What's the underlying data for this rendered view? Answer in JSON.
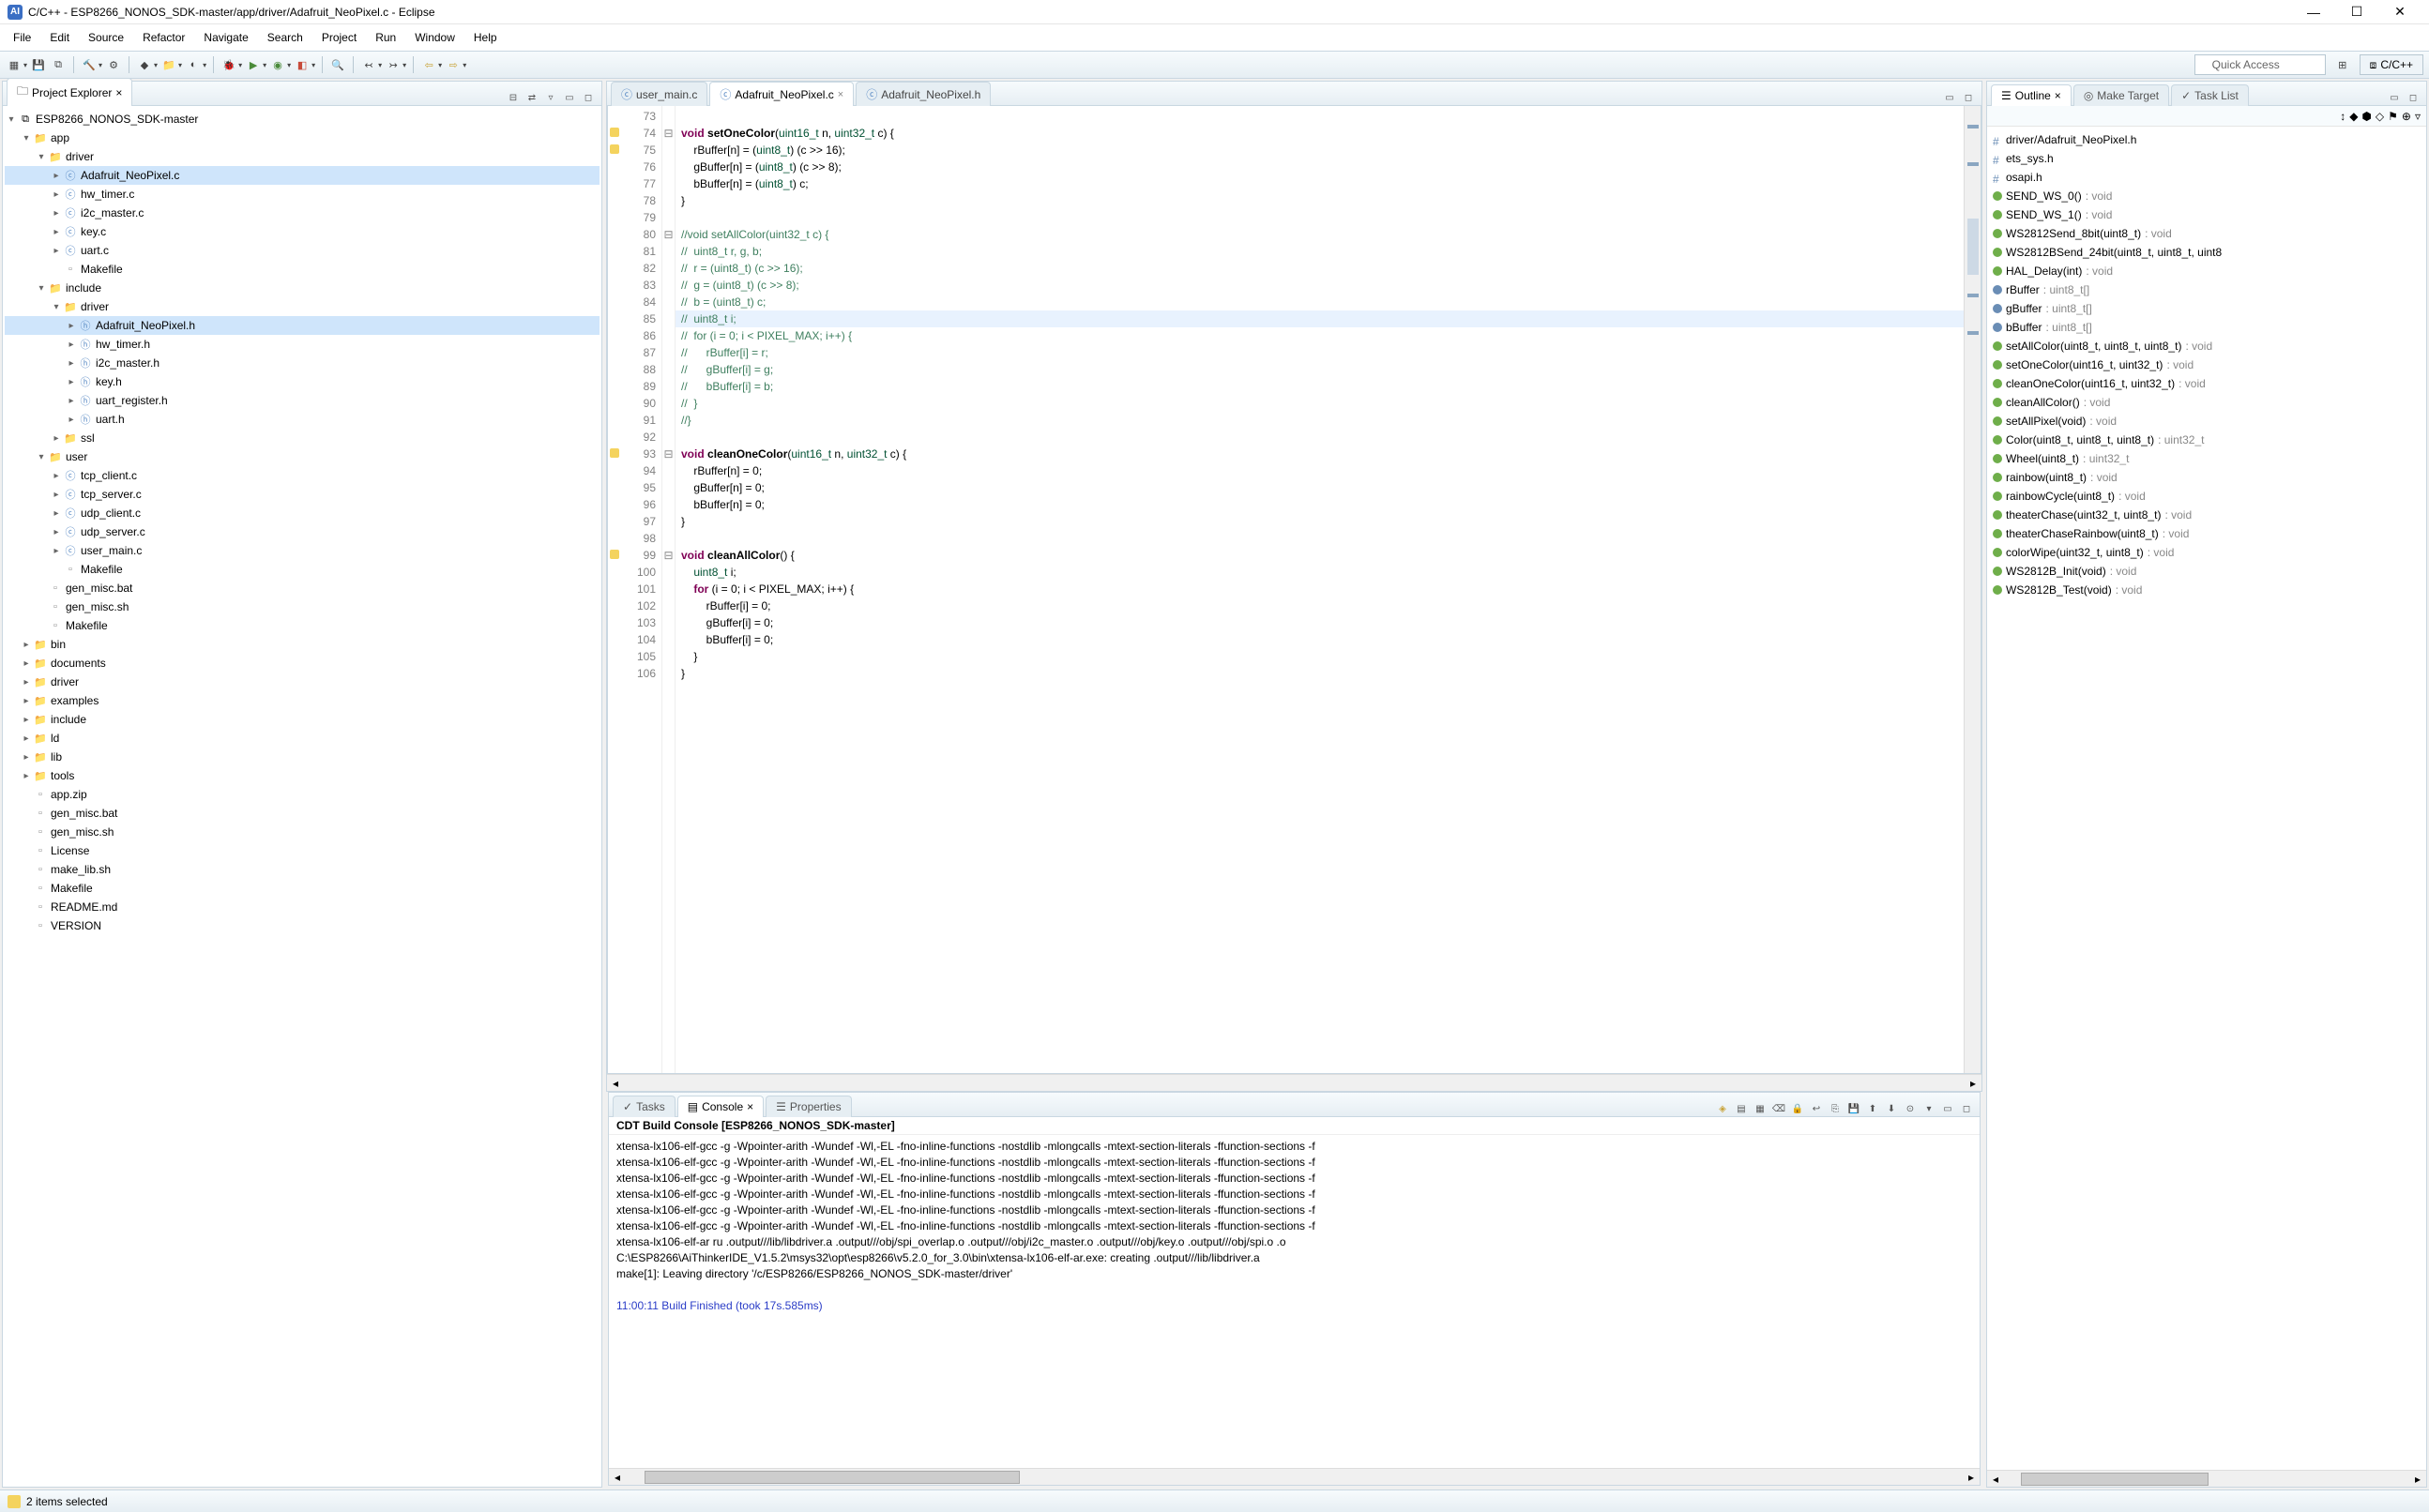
{
  "window": {
    "title": "C/C++ - ESP8266_NONOS_SDK-master/app/driver/Adafruit_NeoPixel.c - Eclipse",
    "app_icon_letter": "AI"
  },
  "menu": [
    "File",
    "Edit",
    "Source",
    "Refactor",
    "Navigate",
    "Search",
    "Project",
    "Run",
    "Window",
    "Help"
  ],
  "toolbar": {
    "quick_access": "Quick Access",
    "perspective": "C/C++"
  },
  "project_explorer": {
    "tab": "Project Explorer",
    "tree": [
      {
        "d": 0,
        "t": "v",
        "i": "proj",
        "l": "ESP8266_NONOS_SDK-master"
      },
      {
        "d": 1,
        "t": "v",
        "i": "folder",
        "l": "app"
      },
      {
        "d": 2,
        "t": "v",
        "i": "folder",
        "l": "driver"
      },
      {
        "d": 3,
        "t": ">",
        "i": "cfile",
        "l": "Adafruit_NeoPixel.c",
        "sel": true
      },
      {
        "d": 3,
        "t": ">",
        "i": "cfile",
        "l": "hw_timer.c"
      },
      {
        "d": 3,
        "t": ">",
        "i": "cfile",
        "l": "i2c_master.c"
      },
      {
        "d": 3,
        "t": ">",
        "i": "cfile",
        "l": "key.c"
      },
      {
        "d": 3,
        "t": ">",
        "i": "cfile",
        "l": "uart.c"
      },
      {
        "d": 3,
        "t": "",
        "i": "file",
        "l": "Makefile"
      },
      {
        "d": 2,
        "t": "v",
        "i": "folder",
        "l": "include"
      },
      {
        "d": 3,
        "t": "v",
        "i": "folder",
        "l": "driver"
      },
      {
        "d": 4,
        "t": ">",
        "i": "hfile",
        "l": "Adafruit_NeoPixel.h",
        "sel": true
      },
      {
        "d": 4,
        "t": ">",
        "i": "hfile",
        "l": "hw_timer.h"
      },
      {
        "d": 4,
        "t": ">",
        "i": "hfile",
        "l": "i2c_master.h"
      },
      {
        "d": 4,
        "t": ">",
        "i": "hfile",
        "l": "key.h"
      },
      {
        "d": 4,
        "t": ">",
        "i": "hfile",
        "l": "uart_register.h"
      },
      {
        "d": 4,
        "t": ">",
        "i": "hfile",
        "l": "uart.h"
      },
      {
        "d": 3,
        "t": ">",
        "i": "folder",
        "l": "ssl"
      },
      {
        "d": 2,
        "t": "v",
        "i": "folder",
        "l": "user"
      },
      {
        "d": 3,
        "t": ">",
        "i": "cfile",
        "l": "tcp_client.c"
      },
      {
        "d": 3,
        "t": ">",
        "i": "cfile",
        "l": "tcp_server.c"
      },
      {
        "d": 3,
        "t": ">",
        "i": "cfile",
        "l": "udp_client.c"
      },
      {
        "d": 3,
        "t": ">",
        "i": "cfile",
        "l": "udp_server.c"
      },
      {
        "d": 3,
        "t": ">",
        "i": "cfile",
        "l": "user_main.c"
      },
      {
        "d": 3,
        "t": "",
        "i": "file",
        "l": "Makefile"
      },
      {
        "d": 2,
        "t": "",
        "i": "file",
        "l": "gen_misc.bat"
      },
      {
        "d": 2,
        "t": "",
        "i": "file",
        "l": "gen_misc.sh"
      },
      {
        "d": 2,
        "t": "",
        "i": "file",
        "l": "Makefile"
      },
      {
        "d": 1,
        "t": ">",
        "i": "folder",
        "l": "bin"
      },
      {
        "d": 1,
        "t": ">",
        "i": "folder",
        "l": "documents"
      },
      {
        "d": 1,
        "t": ">",
        "i": "folder",
        "l": "driver"
      },
      {
        "d": 1,
        "t": ">",
        "i": "folder",
        "l": "examples"
      },
      {
        "d": 1,
        "t": ">",
        "i": "folder",
        "l": "include"
      },
      {
        "d": 1,
        "t": ">",
        "i": "folder",
        "l": "ld"
      },
      {
        "d": 1,
        "t": ">",
        "i": "folder",
        "l": "lib"
      },
      {
        "d": 1,
        "t": ">",
        "i": "folder",
        "l": "tools"
      },
      {
        "d": 1,
        "t": "",
        "i": "file",
        "l": "app.zip"
      },
      {
        "d": 1,
        "t": "",
        "i": "file",
        "l": "gen_misc.bat"
      },
      {
        "d": 1,
        "t": "",
        "i": "file",
        "l": "gen_misc.sh"
      },
      {
        "d": 1,
        "t": "",
        "i": "file",
        "l": "License"
      },
      {
        "d": 1,
        "t": "",
        "i": "file",
        "l": "make_lib.sh"
      },
      {
        "d": 1,
        "t": "",
        "i": "file",
        "l": "Makefile"
      },
      {
        "d": 1,
        "t": "",
        "i": "file",
        "l": "README.md"
      },
      {
        "d": 1,
        "t": "",
        "i": "file",
        "l": "VERSION"
      }
    ]
  },
  "editor": {
    "tabs": [
      {
        "label": "user_main.c",
        "active": false
      },
      {
        "label": "Adafruit_NeoPixel.c",
        "active": true
      },
      {
        "label": "Adafruit_NeoPixel.h",
        "active": false
      }
    ],
    "first_line": 73,
    "highlight_line": 85,
    "lines": [
      {
        "n": 73,
        "html": ""
      },
      {
        "n": 74,
        "mark": "warn",
        "fold": "⊟",
        "html": "<span class='kw'>void</span> <span class='fn'>setOneColor</span>(<span class='type'>uint16_t</span> n, <span class='type'>uint32_t</span> c) {"
      },
      {
        "n": 75,
        "mark": "warn",
        "html": "    rBuffer[n] = (<span class='type'>uint8_t</span>) (c &gt;&gt; 16);"
      },
      {
        "n": 76,
        "html": "    gBuffer[n] = (<span class='type'>uint8_t</span>) (c &gt;&gt; 8);"
      },
      {
        "n": 77,
        "html": "    bBuffer[n] = (<span class='type'>uint8_t</span>) c;"
      },
      {
        "n": 78,
        "html": "}"
      },
      {
        "n": 79,
        "html": ""
      },
      {
        "n": 80,
        "fold": "⊟",
        "html": "<span class='cmt'>//void setAllColor(uint32_t c) {</span>"
      },
      {
        "n": 81,
        "html": "<span class='cmt'>//  uint8_t r, g, b;</span>"
      },
      {
        "n": 82,
        "html": "<span class='cmt'>//  r = (uint8_t) (c &gt;&gt; 16);</span>"
      },
      {
        "n": 83,
        "html": "<span class='cmt'>//  g = (uint8_t) (c &gt;&gt; 8);</span>"
      },
      {
        "n": 84,
        "html": "<span class='cmt'>//  b = (uint8_t) c;</span>"
      },
      {
        "n": 85,
        "html": "<span class='cmt'>//  uint8_t i;</span>"
      },
      {
        "n": 86,
        "html": "<span class='cmt'>//  for (i = 0; i &lt; PIXEL_MAX; i++) {</span>"
      },
      {
        "n": 87,
        "html": "<span class='cmt'>//      rBuffer[i] = r;</span>"
      },
      {
        "n": 88,
        "html": "<span class='cmt'>//      gBuffer[i] = g;</span>"
      },
      {
        "n": 89,
        "html": "<span class='cmt'>//      bBuffer[i] = b;</span>"
      },
      {
        "n": 90,
        "html": "<span class='cmt'>//  }</span>"
      },
      {
        "n": 91,
        "html": "<span class='cmt'>//}</span>"
      },
      {
        "n": 92,
        "html": ""
      },
      {
        "n": 93,
        "mark": "warn",
        "fold": "⊟",
        "html": "<span class='kw'>void</span> <span class='fn'>cleanOneColor</span>(<span class='type'>uint16_t</span> n, <span class='type'>uint32_t</span> c) {"
      },
      {
        "n": 94,
        "html": "    rBuffer[n] = 0;"
      },
      {
        "n": 95,
        "html": "    gBuffer[n] = 0;"
      },
      {
        "n": 96,
        "html": "    bBuffer[n] = 0;"
      },
      {
        "n": 97,
        "html": "}"
      },
      {
        "n": 98,
        "html": ""
      },
      {
        "n": 99,
        "mark": "warn",
        "fold": "⊟",
        "html": "<span class='kw'>void</span> <span class='fn'>cleanAllColor</span>() {"
      },
      {
        "n": 100,
        "html": "    <span class='type'>uint8_t</span> i;"
      },
      {
        "n": 101,
        "html": "    <span class='kw'>for</span> (i = 0; i &lt; PIXEL_MAX; i++) {"
      },
      {
        "n": 102,
        "html": "        rBuffer[i] = 0;"
      },
      {
        "n": 103,
        "html": "        gBuffer[i] = 0;"
      },
      {
        "n": 104,
        "html": "        bBuffer[i] = 0;"
      },
      {
        "n": 105,
        "html": "    }"
      },
      {
        "n": 106,
        "html": "}"
      }
    ]
  },
  "outline": {
    "tabs": [
      "Outline",
      "Make Target",
      "Task List"
    ],
    "items": [
      {
        "k": "inc",
        "nm": "driver/Adafruit_NeoPixel.h"
      },
      {
        "k": "inc",
        "nm": "ets_sys.h"
      },
      {
        "k": "inc",
        "nm": "osapi.h"
      },
      {
        "k": "fn",
        "nm": "SEND_WS_0()",
        "ret": " : void"
      },
      {
        "k": "fn",
        "nm": "SEND_WS_1()",
        "ret": " : void"
      },
      {
        "k": "fn",
        "nm": "WS2812Send_8bit(uint8_t)",
        "ret": " : void"
      },
      {
        "k": "fn",
        "nm": "WS2812BSend_24bit(uint8_t, uint8_t, uint8",
        "ret": ""
      },
      {
        "k": "fn",
        "nm": "HAL_Delay(int)",
        "ret": " : void"
      },
      {
        "k": "var",
        "nm": "rBuffer",
        "ret": " : uint8_t[]"
      },
      {
        "k": "var",
        "nm": "gBuffer",
        "ret": " : uint8_t[]"
      },
      {
        "k": "var",
        "nm": "bBuffer",
        "ret": " : uint8_t[]"
      },
      {
        "k": "fn",
        "nm": "setAllColor(uint8_t, uint8_t, uint8_t)",
        "ret": " : void"
      },
      {
        "k": "fn",
        "nm": "setOneColor(uint16_t, uint32_t)",
        "ret": " : void"
      },
      {
        "k": "fn",
        "nm": "cleanOneColor(uint16_t, uint32_t)",
        "ret": " : void"
      },
      {
        "k": "fn",
        "nm": "cleanAllColor()",
        "ret": " : void"
      },
      {
        "k": "fn",
        "nm": "setAllPixel(void)",
        "ret": " : void"
      },
      {
        "k": "fn",
        "nm": "Color(uint8_t, uint8_t, uint8_t)",
        "ret": " : uint32_t"
      },
      {
        "k": "fn",
        "nm": "Wheel(uint8_t)",
        "ret": " : uint32_t"
      },
      {
        "k": "fn",
        "nm": "rainbow(uint8_t)",
        "ret": " : void"
      },
      {
        "k": "fn",
        "nm": "rainbowCycle(uint8_t)",
        "ret": " : void"
      },
      {
        "k": "fn",
        "nm": "theaterChase(uint32_t, uint8_t)",
        "ret": " : void"
      },
      {
        "k": "fn",
        "nm": "theaterChaseRainbow(uint8_t)",
        "ret": " : void"
      },
      {
        "k": "fn",
        "nm": "colorWipe(uint32_t, uint8_t)",
        "ret": " : void"
      },
      {
        "k": "fn",
        "nm": "WS2812B_Init(void)",
        "ret": " : void"
      },
      {
        "k": "fn",
        "nm": "WS2812B_Test(void)",
        "ret": " : void"
      }
    ]
  },
  "bottom": {
    "tabs": [
      "Tasks",
      "Console",
      "Properties"
    ],
    "active_tab": 1,
    "header": "CDT Build Console [ESP8266_NONOS_SDK-master]",
    "lines": [
      "xtensa-lx106-elf-gcc -g -Wpointer-arith -Wundef -Wl,-EL -fno-inline-functions -nostdlib -mlongcalls -mtext-section-literals -ffunction-sections -f",
      "xtensa-lx106-elf-gcc -g -Wpointer-arith -Wundef -Wl,-EL -fno-inline-functions -nostdlib -mlongcalls -mtext-section-literals -ffunction-sections -f",
      "xtensa-lx106-elf-gcc -g -Wpointer-arith -Wundef -Wl,-EL -fno-inline-functions -nostdlib -mlongcalls -mtext-section-literals -ffunction-sections -f",
      "xtensa-lx106-elf-gcc -g -Wpointer-arith -Wundef -Wl,-EL -fno-inline-functions -nostdlib -mlongcalls -mtext-section-literals -ffunction-sections -f",
      "xtensa-lx106-elf-gcc -g -Wpointer-arith -Wundef -Wl,-EL -fno-inline-functions -nostdlib -mlongcalls -mtext-section-literals -ffunction-sections -f",
      "xtensa-lx106-elf-gcc -g -Wpointer-arith -Wundef -Wl,-EL -fno-inline-functions -nostdlib -mlongcalls -mtext-section-literals -ffunction-sections -f",
      "xtensa-lx106-elf-ar ru .output///lib/libdriver.a .output///obj/spi_overlap.o .output///obj/i2c_master.o .output///obj/key.o .output///obj/spi.o .o",
      "C:\\ESP8266\\AiThinkerIDE_V1.5.2\\msys32\\opt\\esp8266\\v5.2.0_for_3.0\\bin\\xtensa-lx106-elf-ar.exe: creating .output///lib/libdriver.a",
      "make[1]: Leaving directory '/c/ESP8266/ESP8266_NONOS_SDK-master/driver'",
      ""
    ],
    "finished": "11:00:11 Build Finished (took 17s.585ms)"
  },
  "statusbar": {
    "text": "2 items selected"
  }
}
